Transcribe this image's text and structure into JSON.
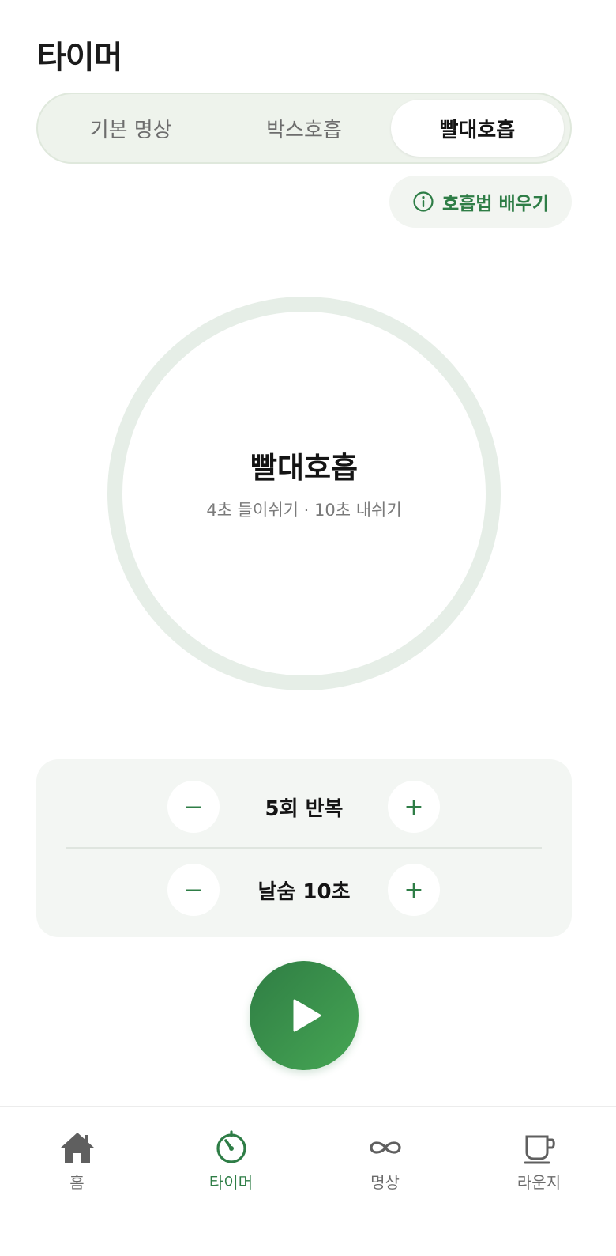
{
  "header": {
    "title": "타이머"
  },
  "modes": {
    "items": [
      {
        "label": "기본 명상"
      },
      {
        "label": "박스호흡"
      },
      {
        "label": "빨대호흡"
      }
    ],
    "selected": "빨대호흡"
  },
  "learn": {
    "label": "호흡법 배우기",
    "icon": "info-icon"
  },
  "breath": {
    "title": "빨대호흡",
    "subtitle": "4초 들이쉬기 · 10초 내쉬기"
  },
  "controls": {
    "repeat_label": "5회 반복",
    "exhale_label": "날숨 10초",
    "minus": "−",
    "plus": "+"
  },
  "play": {
    "icon": "play-icon"
  },
  "nav": {
    "items": [
      {
        "label": "홈",
        "icon": "home-icon"
      },
      {
        "label": "타이머",
        "icon": "timer-icon"
      },
      {
        "label": "명상",
        "icon": "infinity-icon"
      },
      {
        "label": "라운지",
        "icon": "cup-icon"
      }
    ],
    "active": "타이머"
  },
  "colors": {
    "accent": "#2e7d46",
    "accent_light": "#46a654",
    "ring": "#e6eee7",
    "panel": "#f3f6f3"
  }
}
